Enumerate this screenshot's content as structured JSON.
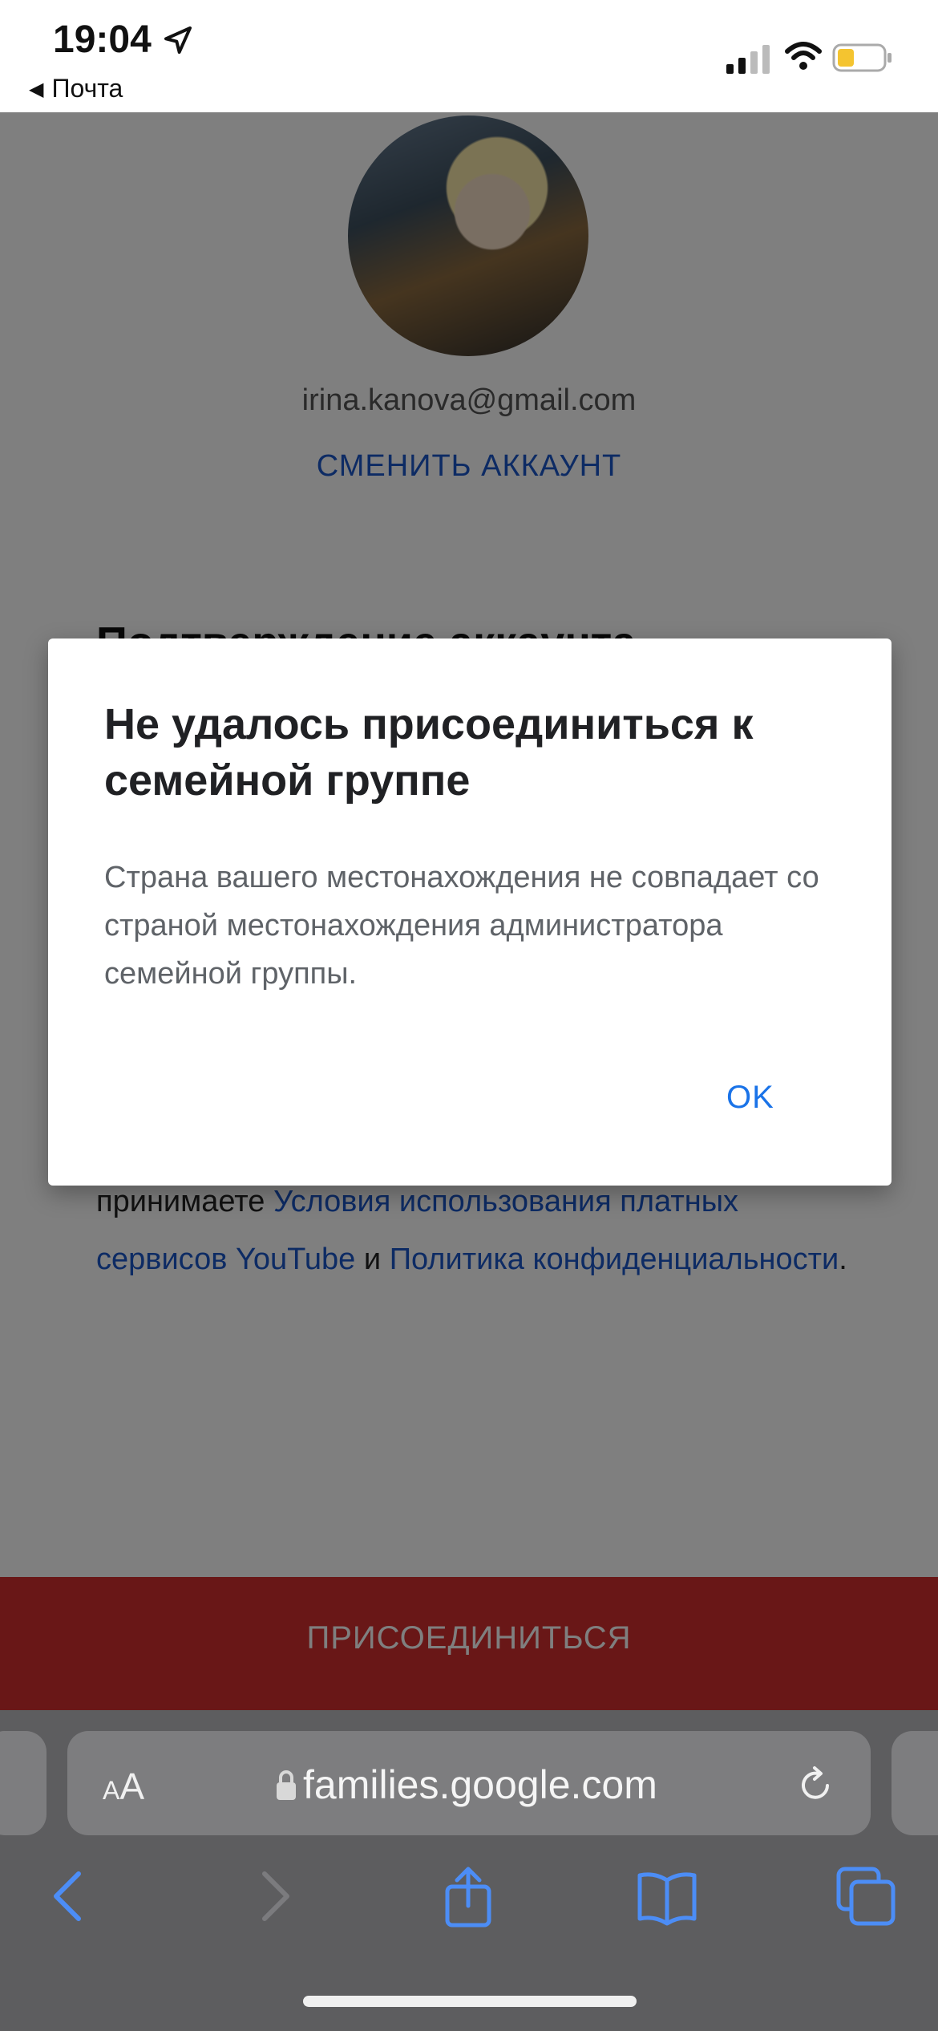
{
  "status_bar": {
    "time": "19:04",
    "back_app": "Почта",
    "icons": [
      "location-arrow-icon",
      "cellular-signal-icon",
      "wifi-icon",
      "battery-low-icon"
    ]
  },
  "account": {
    "email": "irina.kanova@gmail.com",
    "switch_label": "СМЕНИТЬ АККАУНТ"
  },
  "page": {
    "section_title": "Подтверждение аккаунта",
    "terms_prefix": "принимаете",
    "terms_link": "Условия использования платных сервисов YouTube",
    "terms_and": "и",
    "privacy_link": "Политика конфиденциальности",
    "terms_end": ".",
    "join_button": "ПРИСОЕДИНИТЬСЯ"
  },
  "dialog": {
    "title": "Не удалось присоединиться к семейной группе",
    "body": "Страна вашего местонахождения не совпадает со страной местонахождения администратора семейной группы.",
    "ok": "OK"
  },
  "browser": {
    "aa_small": "A",
    "aa_big": "A",
    "url": "families.google.com",
    "toolbar": [
      "back-icon",
      "forward-icon",
      "share-icon",
      "bookmarks-icon",
      "tabs-icon"
    ]
  },
  "colors": {
    "accent": "#1a73e8",
    "join_button": "#d32f2f",
    "browser_bar": "#5d5d5f"
  }
}
